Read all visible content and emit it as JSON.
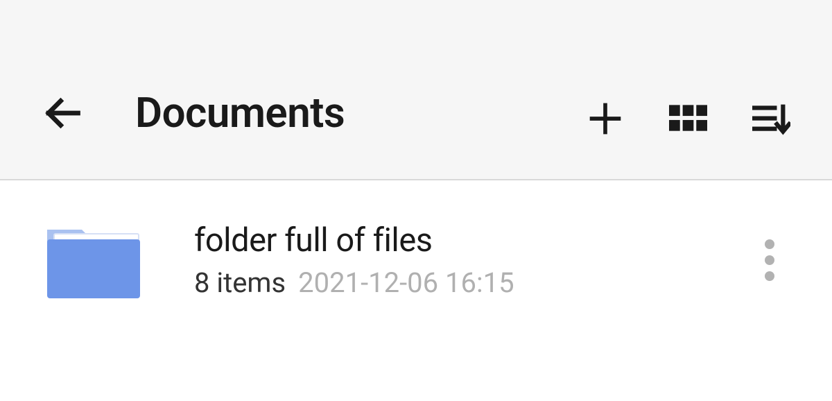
{
  "toolbar": {
    "title": "Documents"
  },
  "items": [
    {
      "name": "folder full of files",
      "count_label": "8 items",
      "date_label": "2021-12-06 16:15"
    }
  ],
  "colors": {
    "folder_primary": "#6d95e8",
    "folder_tab": "#a9c1f0",
    "icon_dark": "#1a1a1a",
    "more_dots": "#b2b2b2"
  }
}
